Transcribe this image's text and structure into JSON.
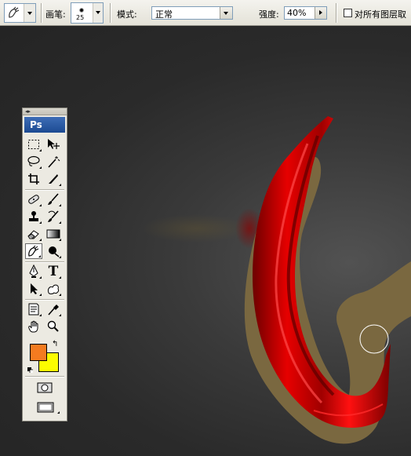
{
  "options_bar": {
    "tool_preset_icon": "smudge-finger-icon",
    "brush_label": "画笔:",
    "brush_size": "25",
    "mode_label": "模式:",
    "mode_value": "正常",
    "strength_label": "强度:",
    "strength_value": "40%",
    "sample_all_layers_label": "对所有图层取",
    "sample_all_layers_checked": false
  },
  "toolbox": {
    "logo": "Ps",
    "active_tool": "smudge-tool",
    "type_tool_glyph": "T",
    "foreground_color": "#f47b20",
    "background_color": "#fcfc00",
    "tools": [
      "rectangular-marquee-tool",
      "move-tool",
      "lasso-tool",
      "magic-wand-tool",
      "crop-tool",
      "slice-tool",
      "healing-brush-tool",
      "brush-tool",
      "clone-stamp-tool",
      "history-brush-tool",
      "eraser-tool",
      "gradient-tool",
      "smudge-tool",
      "dodge-tool",
      "pen-tool",
      "type-tool",
      "path-selection-tool",
      "custom-shape-tool",
      "notes-tool",
      "eyedropper-tool",
      "hand-tool",
      "zoom-tool"
    ]
  },
  "canvas": {
    "background_color": "#2a2a2a",
    "ribbon_color": "#d40000",
    "shadow_color": "#7a6840"
  }
}
